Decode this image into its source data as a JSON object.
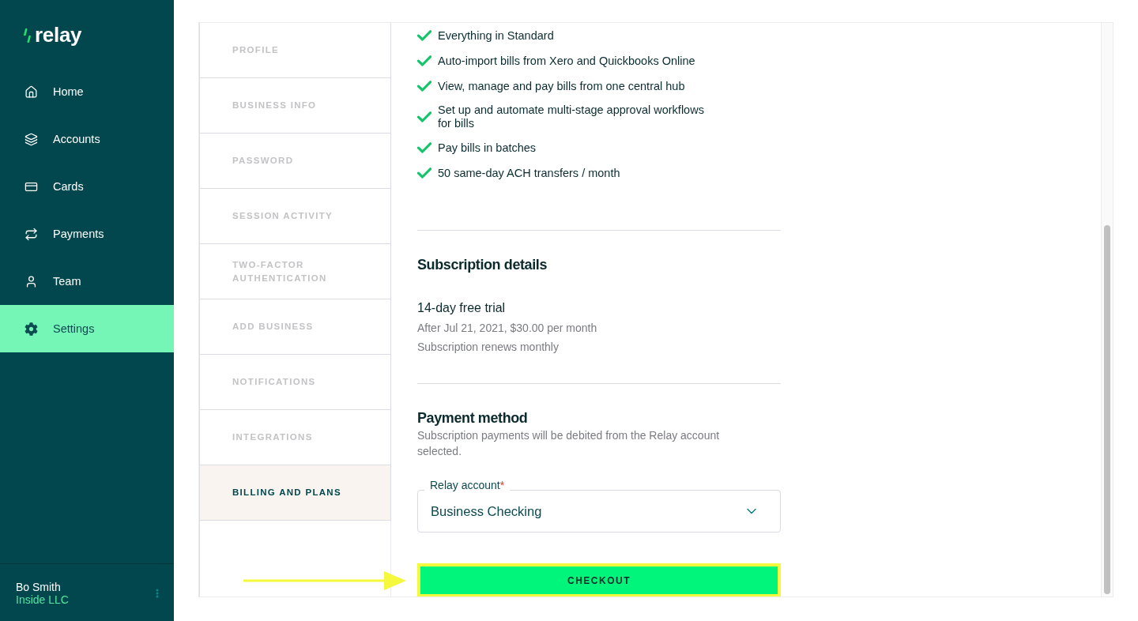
{
  "sidebar": {
    "logo": "relay",
    "items": [
      {
        "label": "Home",
        "selected": false
      },
      {
        "label": "Accounts",
        "selected": false
      },
      {
        "label": "Cards",
        "selected": false
      },
      {
        "label": "Payments",
        "selected": false
      },
      {
        "label": "Team",
        "selected": false
      },
      {
        "label": "Settings",
        "selected": true
      }
    ],
    "user": {
      "name": "Bo Smith",
      "company": "Inside LLC"
    }
  },
  "settings_tabs": [
    {
      "label": "PROFILE",
      "selected": false
    },
    {
      "label": "BUSINESS INFO",
      "selected": false
    },
    {
      "label": "PASSWORD",
      "selected": false
    },
    {
      "label": "SESSION ACTIVITY",
      "selected": false
    },
    {
      "label": "TWO-FACTOR AUTHENTICATION",
      "selected": false
    },
    {
      "label": "ADD BUSINESS",
      "selected": false
    },
    {
      "label": "NOTIFICATIONS",
      "selected": false
    },
    {
      "label": "INTEGRATIONS",
      "selected": false
    },
    {
      "label": "BILLING AND PLANS",
      "selected": true
    }
  ],
  "plan_features": [
    "Everything in Standard",
    "Auto-import bills from Xero and Quickbooks Online",
    "View, manage and pay bills from one central hub",
    "Set up and automate multi-stage approval workflows for bills",
    "Pay bills in batches",
    "50 same-day ACH transfers / month"
  ],
  "subscription_details": {
    "heading": "Subscription details",
    "trial": "14-day free trial",
    "lines": [
      "After Jul 21, 2021, $30.00 per month",
      "Subscription renews monthly"
    ]
  },
  "payment_method": {
    "heading": "Payment method",
    "description": "Subscription payments will be debited from the Relay account selected.",
    "field": {
      "label": "Relay account",
      "required_mark": "*",
      "value": "Business Checking"
    }
  },
  "checkout_button": {
    "label": "CHECKOUT",
    "highlighted": true
  }
}
